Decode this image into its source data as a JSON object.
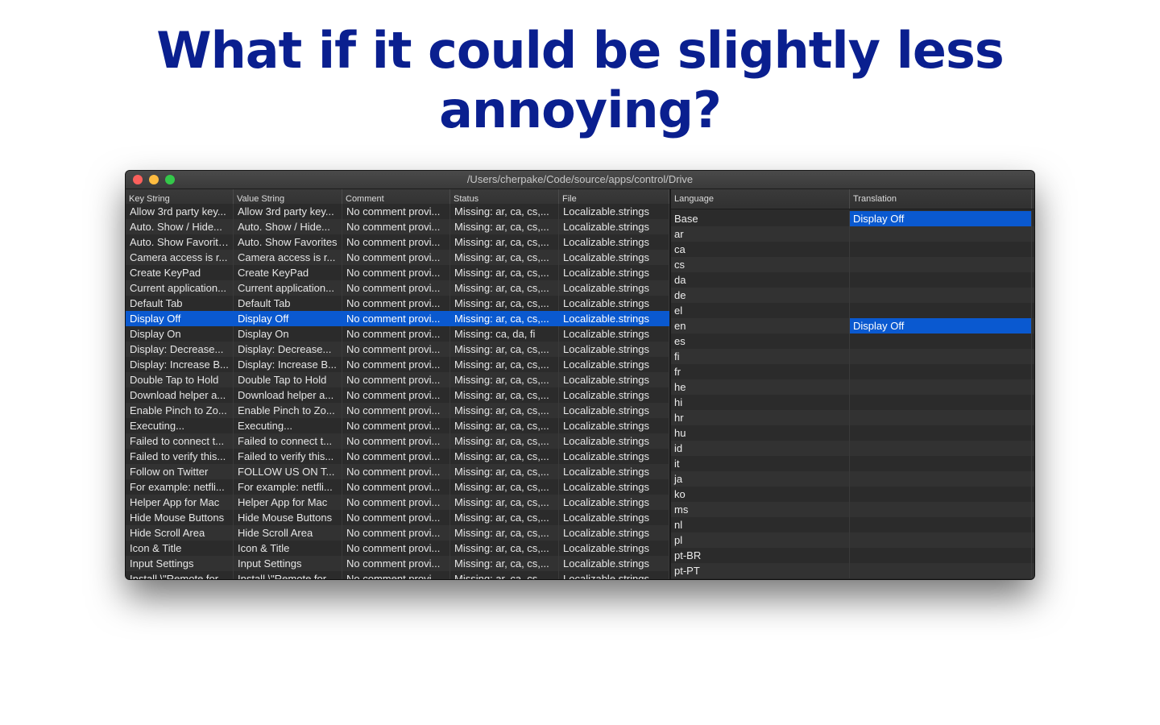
{
  "slide": {
    "title_line1": "What if it could be slightly less",
    "title_line2": "annoying?"
  },
  "window": {
    "title": "/Users/cherpake/Code/source/apps/control/Drive"
  },
  "strings_table": {
    "columns": [
      "Key String",
      "Value String",
      "Comment",
      "Status",
      "File"
    ],
    "selected_row": 7,
    "rows": [
      [
        "Allow 3rd party key...",
        "Allow 3rd party key...",
        "No comment provi...",
        "Missing: ar, ca, cs,...",
        "Localizable.strings"
      ],
      [
        "Auto. Show / Hide...",
        "Auto. Show / Hide...",
        "No comment provi...",
        "Missing: ar, ca, cs,...",
        "Localizable.strings"
      ],
      [
        "Auto. Show Favorites",
        "Auto. Show Favorites",
        "No comment provi...",
        "Missing: ar, ca, cs,...",
        "Localizable.strings"
      ],
      [
        "Camera access is r...",
        "Camera access is r...",
        "No comment provi...",
        "Missing: ar, ca, cs,...",
        "Localizable.strings"
      ],
      [
        "Create KeyPad",
        "Create KeyPad",
        "No comment provi...",
        "Missing: ar, ca, cs,...",
        "Localizable.strings"
      ],
      [
        "Current application...",
        "Current application...",
        "No comment provi...",
        "Missing: ar, ca, cs,...",
        "Localizable.strings"
      ],
      [
        "Default Tab",
        "Default Tab",
        "No comment provi...",
        "Missing: ar, ca, cs,...",
        "Localizable.strings"
      ],
      [
        "Display Off",
        "Display Off",
        "No comment provi...",
        "Missing: ar, ca, cs,...",
        "Localizable.strings"
      ],
      [
        "Display On",
        "Display On",
        "No comment provi...",
        "Missing: ca, da, fi",
        "Localizable.strings"
      ],
      [
        "Display: Decrease...",
        "Display: Decrease...",
        "No comment provi...",
        "Missing: ar, ca, cs,...",
        "Localizable.strings"
      ],
      [
        "Display: Increase B...",
        "Display: Increase B...",
        "No comment provi...",
        "Missing: ar, ca, cs,...",
        "Localizable.strings"
      ],
      [
        "Double Tap to Hold",
        "Double Tap to Hold",
        "No comment provi...",
        "Missing: ar, ca, cs,...",
        "Localizable.strings"
      ],
      [
        "Download helper a...",
        "Download helper a...",
        "No comment provi...",
        "Missing: ar, ca, cs,...",
        "Localizable.strings"
      ],
      [
        "Enable Pinch to Zo...",
        "Enable Pinch to Zo...",
        "No comment provi...",
        "Missing: ar, ca, cs,...",
        "Localizable.strings"
      ],
      [
        "Executing...",
        "Executing...",
        "No comment provi...",
        "Missing: ar, ca, cs,...",
        "Localizable.strings"
      ],
      [
        "Failed to connect t...",
        "Failed to connect t...",
        "No comment provi...",
        "Missing: ar, ca, cs,...",
        "Localizable.strings"
      ],
      [
        "Failed to verify this...",
        "Failed to verify this...",
        "No comment provi...",
        "Missing: ar, ca, cs,...",
        "Localizable.strings"
      ],
      [
        "Follow on Twitter",
        "FOLLOW US ON T...",
        "No comment provi...",
        "Missing: ar, ca, cs,...",
        "Localizable.strings"
      ],
      [
        "For example: netfli...",
        "For example: netfli...",
        "No comment provi...",
        "Missing: ar, ca, cs,...",
        "Localizable.strings"
      ],
      [
        "Helper App for Mac",
        "Helper App for Mac",
        "No comment provi...",
        "Missing: ar, ca, cs,...",
        "Localizable.strings"
      ],
      [
        "Hide Mouse Buttons",
        "Hide Mouse Buttons",
        "No comment provi...",
        "Missing: ar, ca, cs,...",
        "Localizable.strings"
      ],
      [
        "Hide Scroll Area",
        "Hide Scroll Area",
        "No comment provi...",
        "Missing: ar, ca, cs,...",
        "Localizable.strings"
      ],
      [
        "Icon & Title",
        "Icon & Title",
        "No comment provi...",
        "Missing: ar, ca, cs,...",
        "Localizable.strings"
      ],
      [
        "Input Settings",
        "Input Settings",
        "No comment provi...",
        "Missing: ar, ca, cs,...",
        "Localizable.strings"
      ],
      [
        "Install \\\"Remote for...",
        "Install \\\"Remote for...",
        "No comment provi...",
        "Missing: ar, ca, cs,...",
        "Localizable.strings"
      ]
    ]
  },
  "translations_table": {
    "columns": [
      "Language",
      "Translation"
    ],
    "rows": [
      [
        "Base",
        "Display Off"
      ],
      [
        "ar",
        ""
      ],
      [
        "ca",
        ""
      ],
      [
        "cs",
        ""
      ],
      [
        "da",
        ""
      ],
      [
        "de",
        ""
      ],
      [
        "el",
        ""
      ],
      [
        "en",
        "Display Off"
      ],
      [
        "es",
        ""
      ],
      [
        "fi",
        ""
      ],
      [
        "fr",
        ""
      ],
      [
        "he",
        ""
      ],
      [
        "hi",
        ""
      ],
      [
        "hr",
        ""
      ],
      [
        "hu",
        ""
      ],
      [
        "id",
        ""
      ],
      [
        "it",
        ""
      ],
      [
        "ja",
        ""
      ],
      [
        "ko",
        ""
      ],
      [
        "ms",
        ""
      ],
      [
        "nl",
        ""
      ],
      [
        "pl",
        ""
      ],
      [
        "pt-BR",
        ""
      ],
      [
        "pt-PT",
        ""
      ]
    ]
  },
  "colors": {
    "title": "#0a1f8f",
    "selection": "#0a59d0",
    "window_bg": "#2b2b2b"
  }
}
